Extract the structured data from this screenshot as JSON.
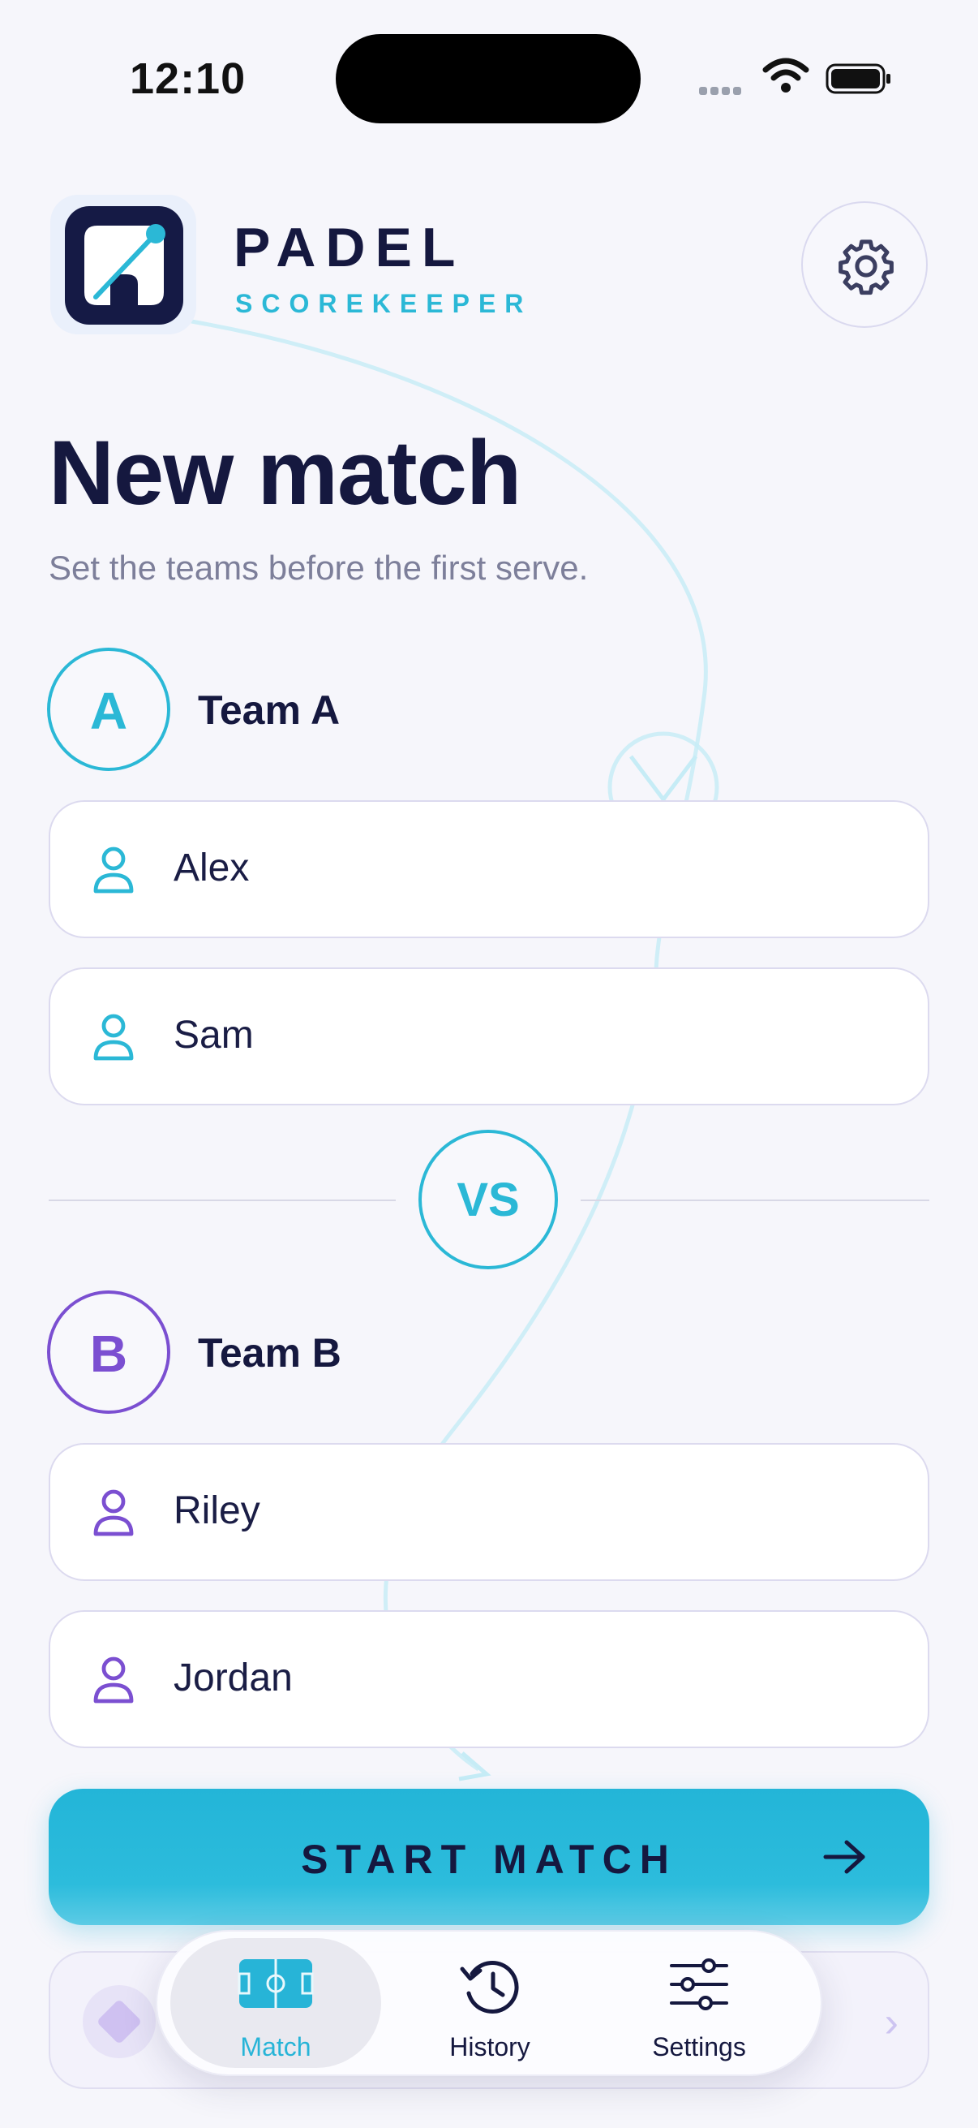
{
  "status_bar": {
    "time": "12:10"
  },
  "header": {
    "brand_title": "PADEL",
    "brand_subtitle": "SCOREKEEPER"
  },
  "page": {
    "title": "New match",
    "subtitle": "Set the teams before the first serve."
  },
  "team_a": {
    "badge": "A",
    "label": "Team A",
    "color": "#2bb8d6",
    "players": [
      "Alex",
      "Sam"
    ]
  },
  "vs_label": "VS",
  "team_b": {
    "badge": "B",
    "label": "Team B",
    "color": "#7b4fd1",
    "players": [
      "Riley",
      "Jordan"
    ]
  },
  "start_button": {
    "label": "START MATCH"
  },
  "tab_bar": {
    "tabs": [
      {
        "label": "Match",
        "icon": "court-icon",
        "active": true
      },
      {
        "label": "History",
        "icon": "history-icon",
        "active": false
      },
      {
        "label": "Settings",
        "icon": "sliders-icon",
        "active": false
      }
    ]
  },
  "colors": {
    "accent": "#2bb8d6",
    "team_b": "#7b4fd1",
    "text": "#15183f",
    "background": "#f6f6fb"
  }
}
